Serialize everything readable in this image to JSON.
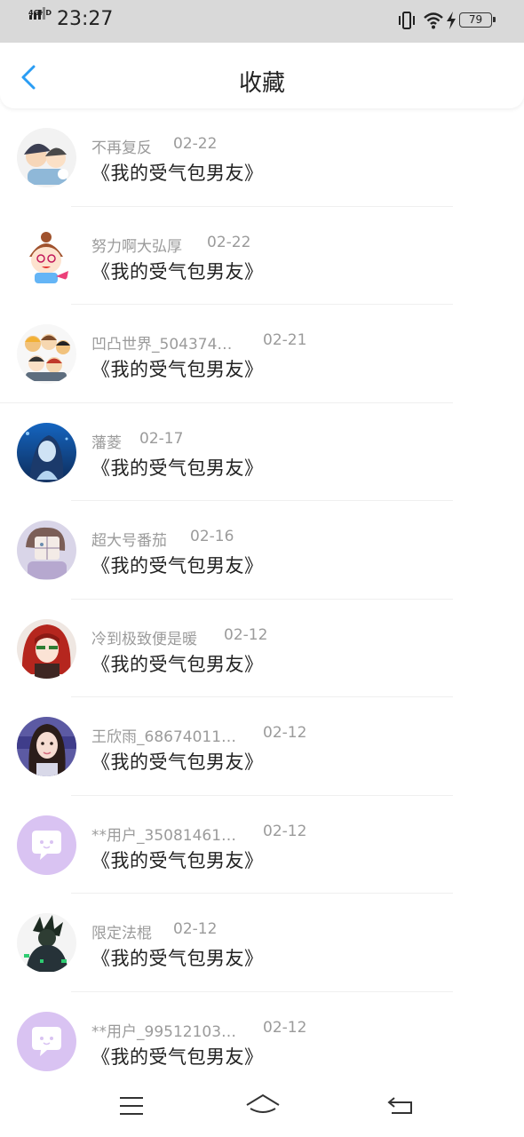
{
  "status_bar": {
    "network": "4GHD",
    "time": "23:27",
    "battery": "79",
    "icons": [
      "signal-icon",
      "vibrate-icon",
      "wifi-icon",
      "charging-icon",
      "battery-icon"
    ]
  },
  "header": {
    "back_icon": "chevron-left-icon",
    "title": "收藏",
    "accent_color": "#2a9df4"
  },
  "favorites": [
    {
      "user": "不再复反",
      "date": "02-22",
      "book": "《我的受气包男友》",
      "avatar": "anime-avatar"
    },
    {
      "user": "努力啊大弘厚",
      "date": "02-22",
      "book": "《我的受气包男友》",
      "avatar": "cartoon-avatar"
    },
    {
      "user": "凹凸世界_504374…",
      "date": "02-21",
      "book": "《我的受气包男友》",
      "avatar": "group-avatar"
    },
    {
      "user": "藩菱",
      "date": "02-17",
      "book": "《我的受气包男友》",
      "avatar": "mermaid-avatar"
    },
    {
      "user": "超大号番茄",
      "date": "02-16",
      "book": "《我的受气包男友》",
      "avatar": "drawn-avatar"
    },
    {
      "user": "冷到极致便是暖",
      "date": "02-12",
      "book": "《我的受气包男友》",
      "avatar": "red-hair-avatar"
    },
    {
      "user": "王欣雨_68674011…",
      "date": "02-12",
      "book": "《我的受气包男友》",
      "avatar": "girl-avatar"
    },
    {
      "user": "**用户_35081461…",
      "date": "02-12",
      "book": "《我的受气包男友》",
      "avatar": "default-chat-avatar"
    },
    {
      "user": "限定法棍",
      "date": "02-12",
      "book": "《我的受气包男友》",
      "avatar": "dark-figure-avatar"
    },
    {
      "user": "**用户_99512103…",
      "date": "02-12",
      "book": "《我的受气包男友》",
      "avatar": "default-chat-avatar"
    }
  ],
  "bottom_nav": [
    "menu-icon",
    "home-icon",
    "back-icon"
  ]
}
